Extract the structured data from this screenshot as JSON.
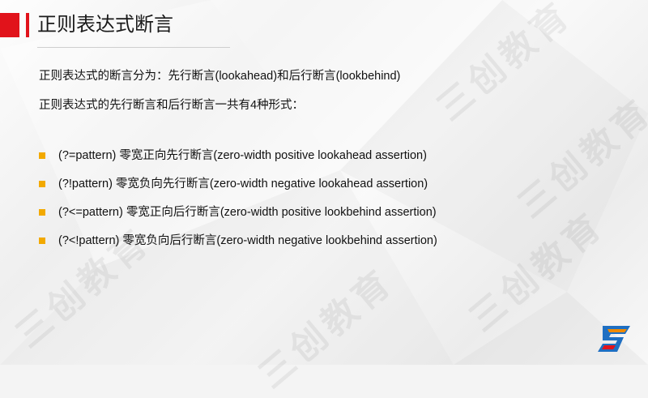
{
  "title": "正则表达式断言",
  "paragraphs": [
    "正则表达式的断言分为：先行断言(lookahead)和后行断言(lookbehind)",
    "正则表达式的先行断言和后行断言一共有4种形式："
  ],
  "items": [
    "(?=pattern) 零宽正向先行断言(zero-width positive lookahead assertion)",
    "(?!pattern) 零宽负向先行断言(zero-width negative lookahead assertion)",
    "(?<=pattern) 零宽正向后行断言(zero-width positive lookbehind assertion)",
    "(?<!pattern) 零宽负向后行断言(zero-width negative lookbehind assertion)"
  ],
  "watermark": "三创教育",
  "colors": {
    "accent": "#e1131b",
    "bullet": "#f2a900",
    "logo_blue": "#1f6fc2",
    "logo_orange": "#f08a00"
  },
  "logo_icon": "company-logo-icon"
}
